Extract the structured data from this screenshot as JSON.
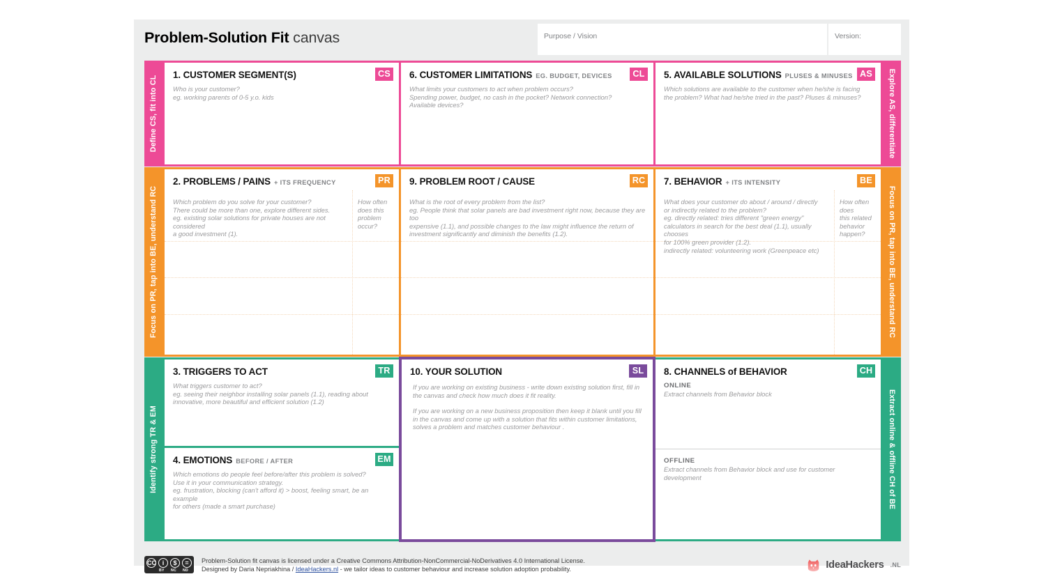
{
  "page": {
    "background": "#ffffff",
    "canvas_background": "#eceded"
  },
  "header": {
    "title_bold": "Problem-Solution Fit",
    "title_light": " canvas",
    "purpose_label": "Purpose / Vision",
    "purpose_value": "",
    "version_label": "Version:",
    "version_value": ""
  },
  "colors": {
    "pink": "#ed4a96",
    "orange": "#f4942a",
    "green": "#2cab84",
    "purple": "#7a4b9c",
    "badge_text": "#ffffff",
    "hint_text": "#9a9a9c",
    "title_text": "#111111",
    "sub_text": "#808285"
  },
  "rails": {
    "left": [
      {
        "text": "Define CS, fit into CL",
        "color": "#ed4a96"
      },
      {
        "text": "Focus on PR, tap into BE, understand RC",
        "color": "#f4942a"
      },
      {
        "text": "Identify strong TR & EM",
        "color": "#2cab84"
      }
    ],
    "right": [
      {
        "text": "Explore AS, differentiate",
        "color": "#ed4a96"
      },
      {
        "text": "Focus on PR, tap into BE, understand RC",
        "color": "#f4942a"
      },
      {
        "text": "Extract online & offline CH of BE",
        "color": "#2cab84"
      }
    ]
  },
  "blocks": {
    "customer_segments": {
      "number_title": "1. CUSTOMER SEGMENT(S)",
      "subtitle": "",
      "code": "CS",
      "hint": "Who is your customer?\neg. working parents of 0-5 y.o. kids"
    },
    "customer_limitations": {
      "number_title": "6. CUSTOMER LIMITATIONS",
      "subtitle": "EG. BUDGET, DEVICES",
      "code": "CL",
      "hint": "What limits your customers to act when problem occurs?\nSpending power, budget, no cash in the pocket? Network connection?\nAvailable devices?"
    },
    "available_solutions": {
      "number_title": "5. AVAILABLE SOLUTIONS",
      "subtitle": "PLUSES & MINUSES",
      "code": "AS",
      "hint": "Which solutions are available to the customer when he/she is facing\nthe problem? What had he/she tried in the past? Pluses & minuses?"
    },
    "problems_pains": {
      "number_title": "2. PROBLEMS / PAINS",
      "subtitle": "+ ITS FREQUENCY",
      "code": "PR",
      "hint": "Which problem do you solve for your customer?\nThere could be more than one, explore different sides.\neg. existing solar solutions for private houses are not considered\na good investment (1).",
      "side_hint": "How often\ndoes this\nproblem\noccur?"
    },
    "problem_root_cause": {
      "number_title": "9. PROBLEM ROOT / CAUSE",
      "subtitle": "",
      "code": "RC",
      "hint": "What is the root of every problem from the list?\neg. People think that solar panels are bad investment right now, because they are too\nexpensive (1.1), and possible changes to the law might influence the return of\ninvestment significantly and diminish the benefits (1.2)."
    },
    "behavior": {
      "number_title": "7. BEHAVIOR",
      "subtitle": "+ ITS INTENSITY",
      "code": "BE",
      "hint": "What does your customer do about / around / directly\nor indirectly related to the problem?\neg. directly related: tries different \"green energy\"\ncalculators in search for the best deal (1.1), usually chooses\nfor 100% green provider (1.2).\nindirectly related: volunteering work (Greenpeace etc)",
      "side_hint": "How often does\nthis related\nbehavior\nhappen?"
    },
    "triggers_to_act": {
      "number_title": "3. TRIGGERS TO ACT",
      "subtitle": "",
      "code": "TR",
      "hint": "What triggers customer to act?\neg. seeing their neighbor installing solar panels (1.1), reading about\ninnovative, more beautiful and efficient solution (1.2)"
    },
    "emotions": {
      "number_title": "4. EMOTIONS",
      "subtitle": "BEFORE / AFTER",
      "code": "EM",
      "hint": "Which emotions do people feel before/after this problem is solved?\nUse it in your communication strategy.\neg. frustration, blocking (can't afford it) > boost, feeling smart, be an example\nfor others (made a smart purchase)"
    },
    "your_solution": {
      "number_title": "10. YOUR SOLUTION",
      "subtitle": "",
      "code": "SL",
      "hint_1": "If you are working on existing business - write down existing solution first, fill in\nthe canvas and check how much does it fit reality.",
      "hint_2": "If you are working on a new business proposition then keep it blank until you fill\nin the canvas and come up with a solution that fits within customer limitations,\nsolves a problem and matches customer behaviour ."
    },
    "channels_of_behavior": {
      "number_title": "8. CHANNELS of BEHAVIOR",
      "subtitle": "",
      "code": "CH",
      "online_label": "ONLINE",
      "online_hint": "Extract channels from Behavior block",
      "offline_label": "OFFLINE",
      "offline_hint": "Extract channels from Behavior block and use for customer development"
    }
  },
  "footer": {
    "license_line_1": "Problem-Solution fit canvas is licensed under a Creative Commons Attribution-NonCommercial-NoDerivatives 4.0 International License.",
    "license_line_2_pre": "Designed by Daria Nepriakhina / ",
    "license_link": "IdeaHackers.nl",
    "license_line_2_post": " - we tailor ideas to customer behaviour and increase solution adoption probability.",
    "cc_marks": [
      "CC",
      "BY",
      "NC",
      "ND"
    ],
    "brand_name": "IdeaHackers",
    "brand_tld": ".NL"
  }
}
